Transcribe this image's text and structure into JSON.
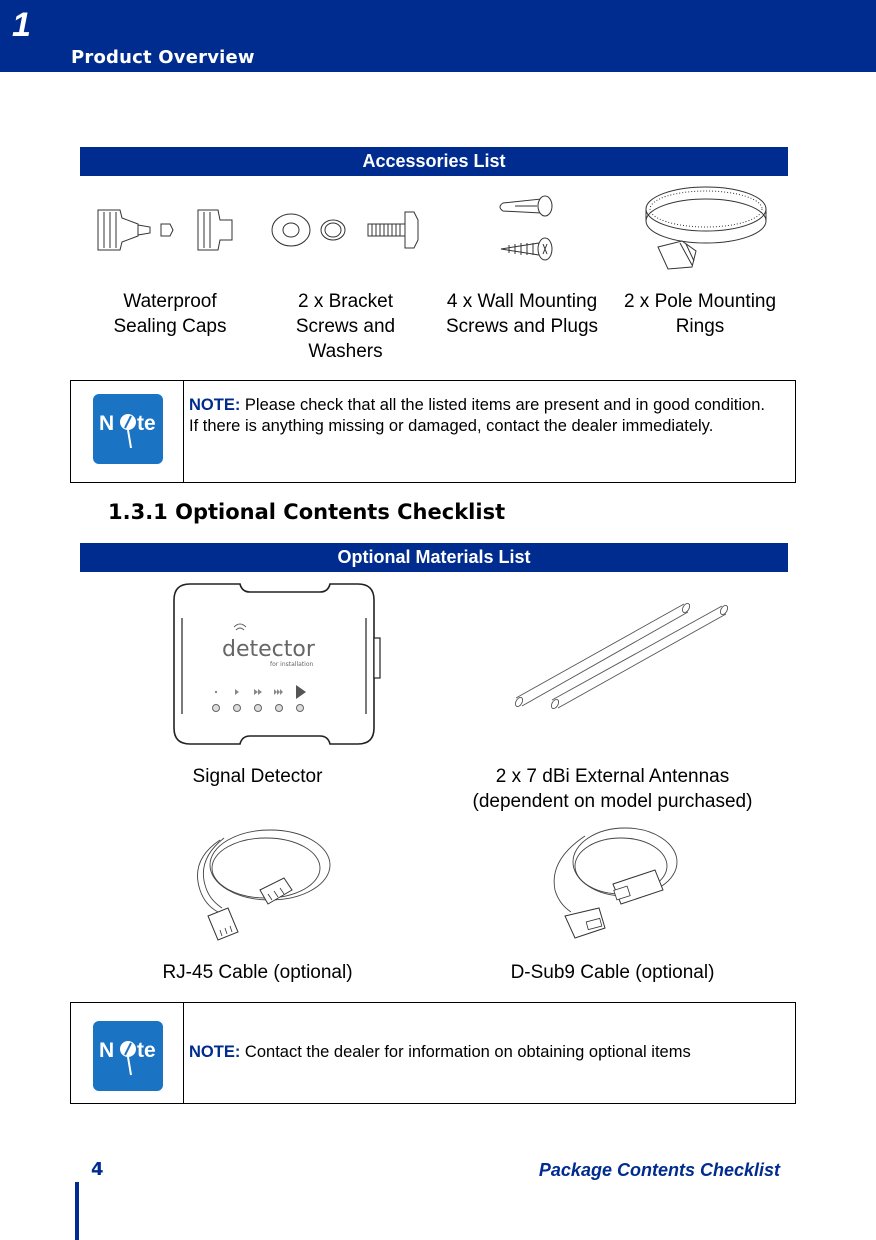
{
  "header": {
    "chapter_number": "1",
    "chapter_title": "Product Overview"
  },
  "accessories": {
    "title": "Accessories List",
    "items": [
      {
        "label": "Waterproof Sealing Caps",
        "icon": "sealing-caps-illustration"
      },
      {
        "label": "2 x Bracket Screws and Washers",
        "icon": "bracket-screws-washers-illustration"
      },
      {
        "label": "4 x Wall Mounting Screws and Plugs",
        "icon": "wall-screws-plugs-illustration"
      },
      {
        "label": "2 x Pole Mounting Rings",
        "icon": "pole-ring-clamp-illustration"
      }
    ]
  },
  "note1": {
    "icon_text": "N te",
    "label": "NOTE:",
    "text": " Please check that all the listed items are present and in good condition. If there is anything missing or damaged, contact the dealer immediately."
  },
  "section": {
    "heading": "1.3.1 Optional Contents Checklist"
  },
  "optional": {
    "title": "Optional Materials List",
    "detector_brand": "detector",
    "detector_sub": "for installation",
    "items": [
      {
        "label": "Signal Detector",
        "icon": "signal-detector-illustration"
      },
      {
        "label": "2 x 7 dBi External Antennas (dependent on model purchased)",
        "line1": "2 x 7 dBi External Antennas",
        "line2": "(dependent on model purchased)",
        "icon": "antennas-illustration"
      },
      {
        "label": "RJ-45 Cable (optional)",
        "icon": "rj45-cable-illustration"
      },
      {
        "label": "D-Sub9 Cable (optional)",
        "icon": "dsub9-cable-illustration"
      }
    ]
  },
  "note2": {
    "label": "NOTE:",
    "text": " Contact the dealer for information on obtaining optional items"
  },
  "footer": {
    "page_number": "4",
    "section_title": "Package Contents Checklist"
  },
  "colors": {
    "brand_blue": "#002b8f",
    "note_icon_blue": "#1b73c4"
  }
}
